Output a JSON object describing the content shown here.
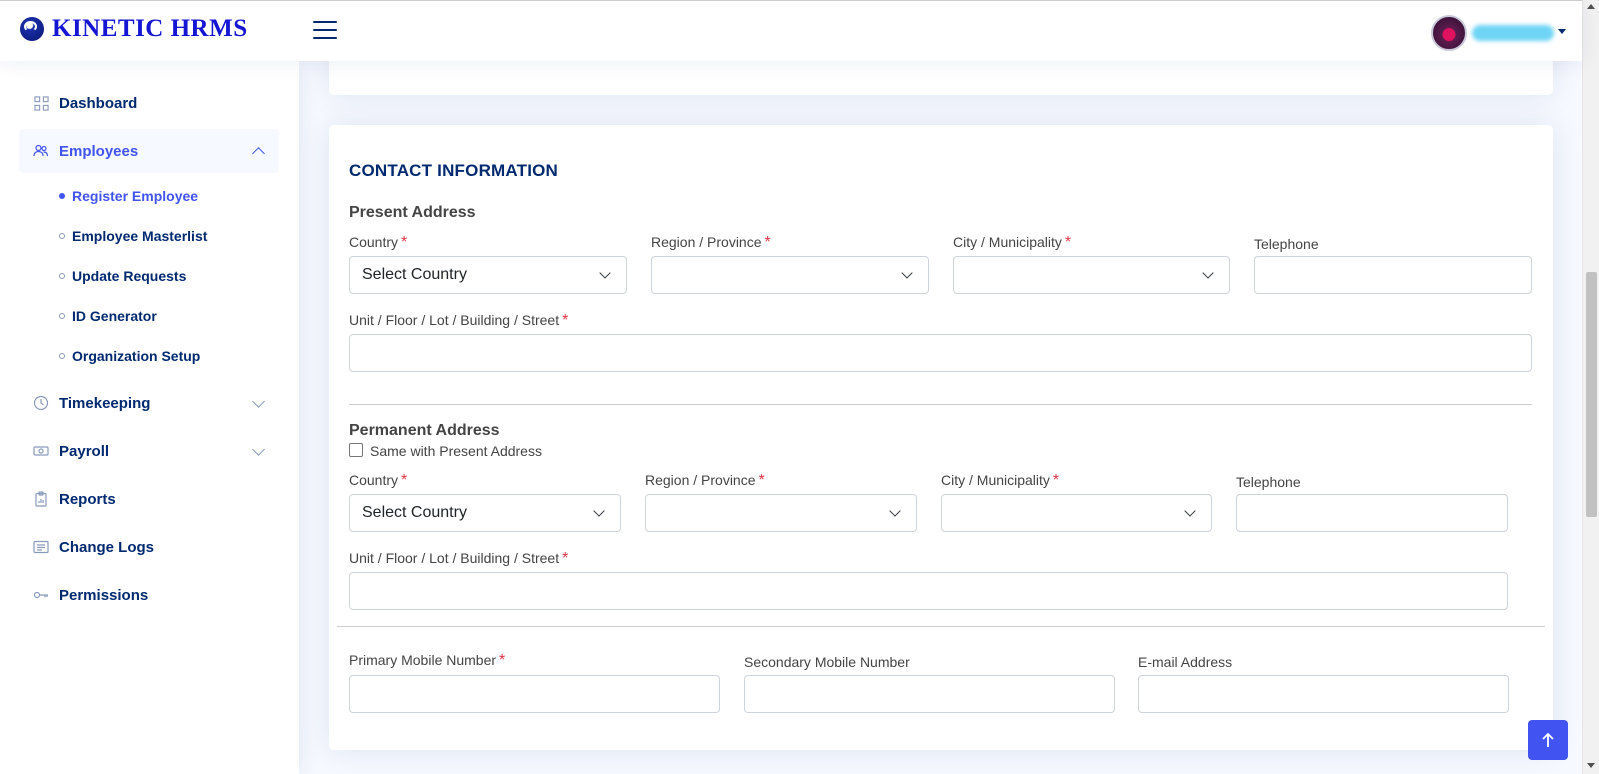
{
  "app": {
    "logo_text": "KINETIC HRMS"
  },
  "header": {
    "menu_icon": "hamburger-icon",
    "user_avatar": "avatar"
  },
  "sidebar": {
    "items": [
      {
        "label": "Dashboard",
        "icon": "grid-icon"
      },
      {
        "label": "Employees",
        "icon": "people-icon",
        "expanded": true
      },
      {
        "label": "Timekeeping",
        "icon": "clock-icon"
      },
      {
        "label": "Payroll",
        "icon": "cash-icon"
      },
      {
        "label": "Reports",
        "icon": "clipboard-data-icon"
      },
      {
        "label": "Change Logs",
        "icon": "list-icon"
      },
      {
        "label": "Permissions",
        "icon": "key-icon"
      }
    ],
    "employees_sub": [
      {
        "label": "Register Employee",
        "active": true
      },
      {
        "label": "Employee Masterlist"
      },
      {
        "label": "Update Requests"
      },
      {
        "label": "ID Generator"
      },
      {
        "label": "Organization Setup"
      }
    ]
  },
  "contact": {
    "title": "CONTACT INFORMATION",
    "required_mark": "*",
    "present": {
      "heading": "Present Address",
      "country_label": "Country",
      "country_value": "Select Country",
      "region_label": "Region / Province",
      "city_label": "City / Municipality",
      "telephone_label": "Telephone",
      "street_label": "Unit / Floor / Lot / Building / Street"
    },
    "permanent": {
      "heading": "Permanent Address",
      "same_label": "Same with Present Address",
      "country_label": "Country",
      "country_value": "Select Country",
      "region_label": "Region / Province",
      "city_label": "City / Municipality",
      "telephone_label": "Telephone",
      "street_label": "Unit / Floor / Lot / Building / Street"
    },
    "primary_mobile_label": "Primary Mobile Number",
    "secondary_mobile_label": "Secondary Mobile Number",
    "email_label": "E-mail Address"
  },
  "colors": {
    "brand": "#1515d4",
    "accent": "#4154f1",
    "nav_text": "#012970",
    "required": "#dc3545"
  }
}
